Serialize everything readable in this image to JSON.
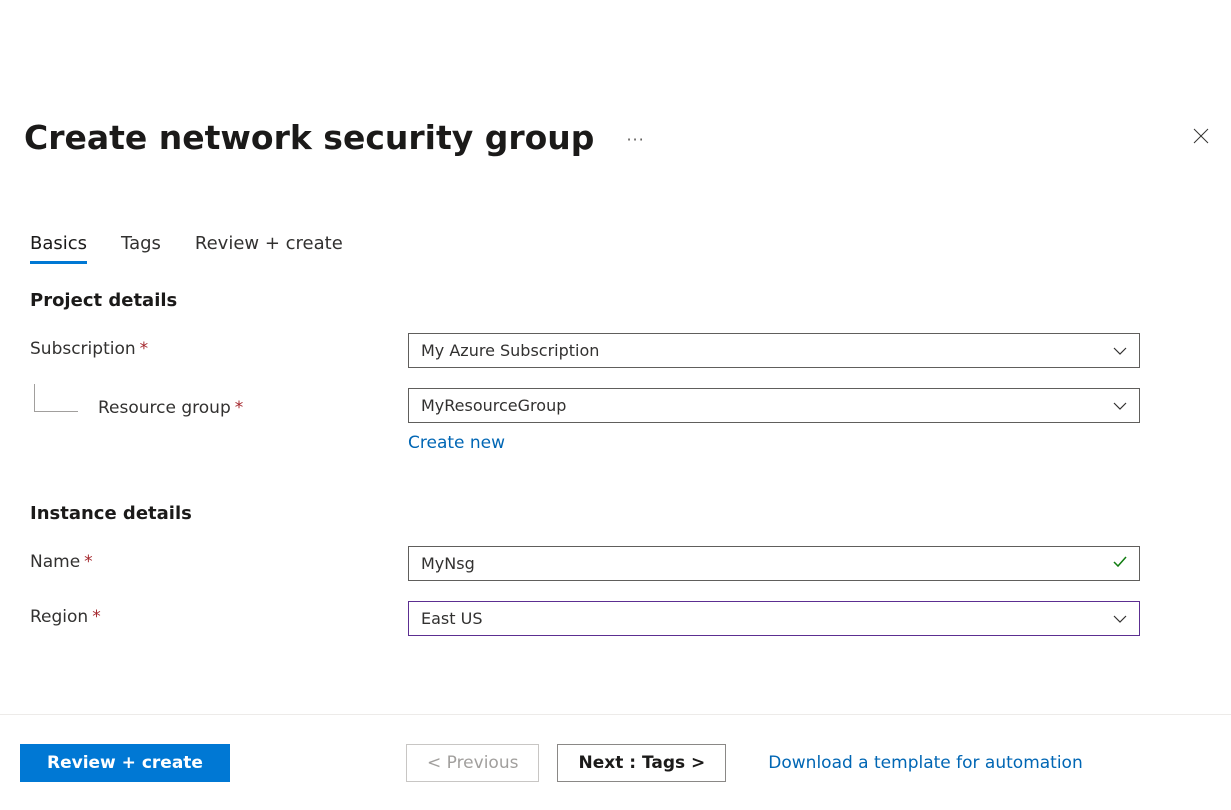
{
  "header": {
    "title": "Create network security group"
  },
  "tabs": [
    {
      "label": "Basics",
      "active": true
    },
    {
      "label": "Tags",
      "active": false
    },
    {
      "label": "Review + create",
      "active": false
    }
  ],
  "sections": {
    "project": {
      "heading": "Project details",
      "subscription_label": "Subscription",
      "subscription_value": "My Azure Subscription",
      "resource_group_label": "Resource group",
      "resource_group_value": "MyResourceGroup",
      "create_new_label": "Create new"
    },
    "instance": {
      "heading": "Instance details",
      "name_label": "Name",
      "name_value": "MyNsg",
      "region_label": "Region",
      "region_value": "East US"
    }
  },
  "footer": {
    "review_create": "Review + create",
    "previous": "< Previous",
    "next": "Next : Tags >",
    "download_template": "Download a template for automation"
  }
}
